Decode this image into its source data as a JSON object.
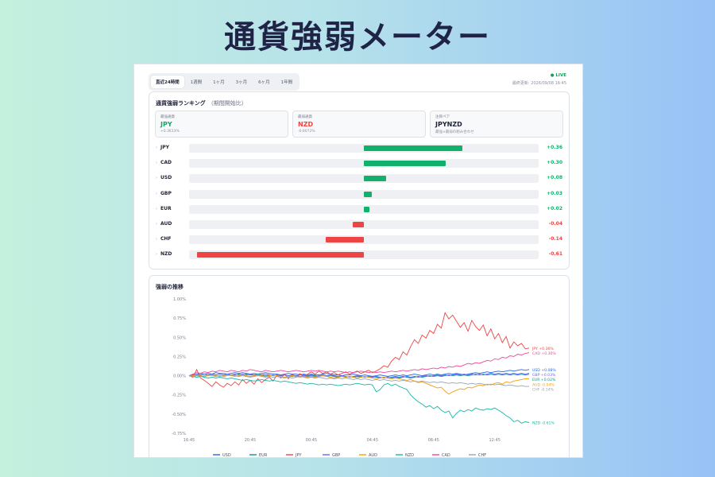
{
  "headline": "通貨強弱メーター",
  "tabs": [
    "直近24時間",
    "1週間",
    "1ヶ月",
    "3ヶ月",
    "6ヶ月",
    "1年間"
  ],
  "active_tab": 0,
  "live_label": "● LIVE",
  "updated": "最終更新: 2026/09/08 16:45",
  "ranking": {
    "title": "通貨強弱ランキング",
    "subtitle": "（期間開始比）",
    "stats": [
      {
        "label": "最強通貨",
        "value": "JPY",
        "sub": "+0.3613%",
        "color": "#12a866"
      },
      {
        "label": "最弱通貨",
        "value": "NZD",
        "sub": "-0.6072%",
        "color": "#ef4444"
      },
      {
        "label": "注目ペア",
        "value": "JPYNZD",
        "sub": "最強×最弱の組み合わせ",
        "color": "#1e2235"
      }
    ],
    "rows": [
      {
        "currency": "JPY",
        "value": 0.36,
        "label": "+0.36"
      },
      {
        "currency": "CAD",
        "value": 0.3,
        "label": "+0.30"
      },
      {
        "currency": "USD",
        "value": 0.08,
        "label": "+0.08"
      },
      {
        "currency": "GBP",
        "value": 0.03,
        "label": "+0.03"
      },
      {
        "currency": "EUR",
        "value": 0.02,
        "label": "+0.02"
      },
      {
        "currency": "AUD",
        "value": -0.04,
        "label": "-0.04"
      },
      {
        "currency": "CHF",
        "value": -0.14,
        "label": "-0.14"
      },
      {
        "currency": "NZD",
        "value": -0.61,
        "label": "-0.61"
      }
    ],
    "bar_scale_max": 0.61,
    "positive_color": "#12b06a",
    "negative_color": "#ef4444"
  },
  "trend": {
    "title": "強弱の推移"
  },
  "chart_data": {
    "type": "line",
    "x_ticks": [
      "16:45",
      "20:45",
      "00:45",
      "04:45",
      "08:45",
      "12:45"
    ],
    "x_tick_index": [
      0,
      16,
      32,
      48,
      64,
      80
    ],
    "y_ticks": [
      "1.00%",
      "0.75%",
      "0.50%",
      "0.25%",
      "0.00%",
      "-0.25%",
      "-0.50%",
      "-0.75%"
    ],
    "ylim": [
      -0.75,
      1.0
    ],
    "y_tick_values": [
      1.0,
      0.75,
      0.5,
      0.25,
      0.0,
      -0.25,
      -0.5,
      -0.75
    ],
    "series": [
      {
        "name": "USD",
        "color": "#2563eb",
        "end_label": "USD +0.08%",
        "values": [
          0,
          0.01,
          0.02,
          0.03,
          0.02,
          0.03,
          0.02,
          0.04,
          0.03,
          0.03,
          0.02,
          0.03,
          0.04,
          0.03,
          0.04,
          0.03,
          0.02,
          0.03,
          0.02,
          0.03,
          0.04,
          0.03,
          0.02,
          0.02,
          0.01,
          0.02,
          0.03,
          0.02,
          0.02,
          0.01,
          0.02,
          0.01,
          0.02,
          0.01,
          0.01,
          0.02,
          0.03,
          0.02,
          0.01,
          0.01,
          0,
          0.01,
          0.01,
          0.02,
          0.01,
          0,
          0.01,
          0,
          -0.01,
          0,
          0.01,
          0,
          -0.01,
          0,
          0.01,
          0,
          0.01,
          0,
          0.01,
          0.02,
          0.01,
          0,
          0.01,
          0.02,
          0.01,
          0.02,
          0.01,
          0.02,
          0.03,
          0.02,
          0.03,
          0.02,
          0.01,
          0.02,
          0.03,
          0.04,
          0.03,
          0.04,
          0.05,
          0.04,
          0.05,
          0.06,
          0.05,
          0.06,
          0.07,
          0.06,
          0.07,
          0.08,
          0.07,
          0.08
        ]
      },
      {
        "name": "EUR",
        "color": "#0d9488",
        "end_label": "EUR +0.02%",
        "values": [
          0,
          0.01,
          0,
          0.01,
          0.02,
          0.01,
          0.02,
          0.01,
          0.02,
          0.01,
          0.02,
          0.01,
          0.01,
          0.02,
          0.01,
          0.02,
          0.01,
          0.01,
          0.02,
          0.01,
          0,
          0.01,
          0,
          0.01,
          0,
          0.01,
          0,
          0.01,
          0,
          0.01,
          0.01,
          0,
          0.01,
          0,
          -0.01,
          0,
          -0.01,
          0,
          -0.01,
          -0.02,
          -0.01,
          -0.02,
          -0.01,
          -0.02,
          -0.01,
          -0.02,
          -0.01,
          -0.02,
          -0.01,
          -0.02,
          -0.03,
          -0.02,
          -0.03,
          -0.02,
          -0.01,
          -0.02,
          -0.01,
          -0.02,
          -0.03,
          -0.02,
          -0.01,
          -0.02,
          -0.01,
          0,
          -0.01,
          0,
          -0.01,
          0,
          0.01,
          0,
          0.01,
          0,
          0.01,
          0,
          0.01,
          0.02,
          0.01,
          0.02,
          0.01,
          0.02,
          0.01,
          0.02,
          0.01,
          0.02,
          0.01,
          0.02,
          0.01,
          0.02,
          0.01,
          0.02
        ]
      },
      {
        "name": "JPY",
        "color": "#ef4444",
        "end_label": "JPY +0.36%",
        "values": [
          0,
          -0.02,
          0.08,
          -0.03,
          -0.06,
          -0.1,
          -0.14,
          -0.08,
          -0.12,
          -0.15,
          -0.1,
          -0.13,
          -0.08,
          -0.12,
          -0.05,
          -0.1,
          -0.06,
          -0.11,
          -0.04,
          -0.09,
          -0.05,
          -0.02,
          -0.07,
          0.01,
          -0.03,
          0.02,
          -0.04,
          0.02,
          -0.02,
          0.03,
          -0.01,
          0.02,
          0.05,
          0.02,
          0.06,
          0.03,
          0.05,
          0.02,
          0.04,
          0.01,
          0.03,
          0.05,
          0.02,
          0.04,
          0.06,
          0.03,
          0.05,
          0.07,
          0.04,
          0.06,
          0.09,
          0.13,
          0.11,
          0.19,
          0.24,
          0.21,
          0.31,
          0.27,
          0.38,
          0.47,
          0.42,
          0.53,
          0.49,
          0.59,
          0.55,
          0.67,
          0.62,
          0.82,
          0.74,
          0.79,
          0.71,
          0.63,
          0.69,
          0.58,
          0.72,
          0.64,
          0.59,
          0.66,
          0.52,
          0.61,
          0.48,
          0.55,
          0.43,
          0.51,
          0.36,
          0.44,
          0.39,
          0.42,
          0.35,
          0.36
        ]
      },
      {
        "name": "GBP",
        "color": "#6366f1",
        "end_label": "GBP +0.03%",
        "values": [
          0,
          0.01,
          0.02,
          0.01,
          0.02,
          0.03,
          0.02,
          0.01,
          0.02,
          0.01,
          0.02,
          0.01,
          0.02,
          0.01,
          0.02,
          0.01,
          0.02,
          0.01,
          0,
          0.01,
          0.02,
          0.01,
          0,
          0.01,
          0,
          0.01,
          0,
          -0.01,
          0,
          -0.01,
          0,
          -0.01,
          0,
          -0.01,
          0,
          0.01,
          0,
          0.01,
          0,
          -0.01,
          0,
          -0.01,
          -0.02,
          -0.01,
          0,
          -0.01,
          -0.02,
          -0.01,
          -0.02,
          -0.01,
          -0.02,
          -0.03,
          -0.02,
          -0.03,
          -0.02,
          -0.03,
          -0.02,
          -0.01,
          -0.02,
          -0.01,
          -0.02,
          -0.01,
          0,
          -0.01,
          0,
          0.01,
          0,
          0.01,
          0,
          0.01,
          0.02,
          0.01,
          0.02,
          0.01,
          0.02,
          0.01,
          0.02,
          0.01,
          0.02,
          0.03,
          0.02,
          0.03,
          0.02,
          0.03,
          0.02,
          0.03,
          0.02,
          0.03,
          0.02,
          0.03
        ]
      },
      {
        "name": "AUD",
        "color": "#f59e0b",
        "end_label": "AUD -0.04%",
        "values": [
          0,
          0,
          0.01,
          0,
          -0.01,
          0,
          0.01,
          0,
          -0.01,
          0,
          0.01,
          0,
          -0.01,
          0,
          0.01,
          0,
          -0.01,
          0,
          0.01,
          0,
          -0.01,
          0,
          0.01,
          0,
          -0.01,
          -0.02,
          -0.01,
          0,
          -0.01,
          -0.02,
          -0.01,
          -0.02,
          -0.01,
          -0.02,
          -0.01,
          0,
          -0.01,
          -0.02,
          -0.03,
          -0.02,
          -0.01,
          -0.02,
          -0.01,
          -0.02,
          -0.03,
          -0.02,
          -0.01,
          -0.02,
          -0.03,
          -0.04,
          -0.03,
          -0.02,
          -0.03,
          -0.04,
          -0.03,
          -0.04,
          -0.05,
          -0.06,
          -0.05,
          -0.07,
          -0.09,
          -0.08,
          -0.1,
          -0.12,
          -0.14,
          -0.16,
          -0.15,
          -0.2,
          -0.24,
          -0.21,
          -0.19,
          -0.17,
          -0.18,
          -0.15,
          -0.16,
          -0.14,
          -0.12,
          -0.13,
          -0.11,
          -0.12,
          -0.1,
          -0.09,
          -0.11,
          -0.08,
          -0.09,
          -0.07,
          -0.06,
          -0.05,
          -0.04,
          -0.04
        ]
      },
      {
        "name": "NZD",
        "color": "#14b8a6",
        "end_label": "NZD -0.61%",
        "values": [
          0,
          -0.01,
          -0.02,
          -0.01,
          -0.02,
          -0.03,
          -0.02,
          -0.03,
          -0.02,
          -0.03,
          -0.04,
          -0.03,
          -0.04,
          -0.05,
          -0.06,
          -0.05,
          -0.06,
          -0.07,
          -0.06,
          -0.05,
          -0.06,
          -0.07,
          -0.06,
          -0.07,
          -0.08,
          -0.07,
          -0.08,
          -0.09,
          -0.1,
          -0.09,
          -0.1,
          -0.11,
          -0.1,
          -0.11,
          -0.12,
          -0.11,
          -0.12,
          -0.11,
          -0.12,
          -0.13,
          -0.12,
          -0.11,
          -0.12,
          -0.11,
          -0.1,
          -0.11,
          -0.12,
          -0.11,
          -0.12,
          -0.21,
          -0.18,
          -0.12,
          -0.1,
          -0.13,
          -0.11,
          -0.14,
          -0.16,
          -0.18,
          -0.25,
          -0.3,
          -0.34,
          -0.37,
          -0.41,
          -0.39,
          -0.43,
          -0.4,
          -0.45,
          -0.48,
          -0.46,
          -0.55,
          -0.49,
          -0.45,
          -0.47,
          -0.44,
          -0.46,
          -0.42,
          -0.44,
          -0.45,
          -0.43,
          -0.44,
          -0.42,
          -0.45,
          -0.48,
          -0.52,
          -0.55,
          -0.6,
          -0.58,
          -0.62,
          -0.6,
          -0.61
        ]
      },
      {
        "name": "CAD",
        "color": "#ec4899",
        "end_label": "CAD +0.30%",
        "values": [
          0,
          0.02,
          0.04,
          0.03,
          0.05,
          0.04,
          0.06,
          0.05,
          0.07,
          0.06,
          0.05,
          0.07,
          0.06,
          0.05,
          0.07,
          0.06,
          0.08,
          0.07,
          0.06,
          0.05,
          0.07,
          0.06,
          0.05,
          0.06,
          0.07,
          0.06,
          0.05,
          0.06,
          0.07,
          0.06,
          0.05,
          0.06,
          0.07,
          0.06,
          0.07,
          0.06,
          0.05,
          0.06,
          0.05,
          0.06,
          0.05,
          0.04,
          0.05,
          0.04,
          0.05,
          0.06,
          0.05,
          0.04,
          0.05,
          0.04,
          0.05,
          0.04,
          0.05,
          0.06,
          0.05,
          0.06,
          0.07,
          0.06,
          0.07,
          0.08,
          0.07,
          0.09,
          0.08,
          0.09,
          0.1,
          0.09,
          0.11,
          0.1,
          0.12,
          0.11,
          0.13,
          0.12,
          0.14,
          0.16,
          0.15,
          0.17,
          0.16,
          0.18,
          0.2,
          0.19,
          0.22,
          0.21,
          0.24,
          0.23,
          0.26,
          0.25,
          0.28,
          0.27,
          0.29,
          0.3
        ]
      },
      {
        "name": "CHF",
        "color": "#94a3b8",
        "end_label": "CHF -0.14%",
        "values": [
          0,
          -0.01,
          0,
          -0.01,
          0,
          0.01,
          0,
          -0.01,
          0,
          -0.01,
          0,
          0.01,
          0,
          -0.01,
          0,
          -0.01,
          -0.02,
          -0.01,
          0,
          -0.01,
          -0.02,
          -0.01,
          -0.02,
          -0.01,
          -0.02,
          -0.03,
          -0.02,
          -0.03,
          -0.02,
          -0.01,
          -0.02,
          -0.03,
          -0.02,
          -0.03,
          -0.02,
          -0.03,
          -0.04,
          -0.03,
          -0.04,
          -0.03,
          -0.04,
          -0.03,
          -0.04,
          -0.05,
          -0.04,
          -0.05,
          -0.04,
          -0.05,
          -0.06,
          -0.05,
          -0.06,
          -0.05,
          -0.06,
          -0.07,
          -0.06,
          -0.07,
          -0.06,
          -0.07,
          -0.08,
          -0.07,
          -0.08,
          -0.07,
          -0.08,
          -0.09,
          -0.08,
          -0.09,
          -0.08,
          -0.09,
          -0.1,
          -0.09,
          -0.1,
          -0.09,
          -0.1,
          -0.11,
          -0.1,
          -0.11,
          -0.1,
          -0.11,
          -0.12,
          -0.11,
          -0.12,
          -0.11,
          -0.12,
          -0.13,
          -0.12,
          -0.13,
          -0.14,
          -0.13,
          -0.14,
          -0.14
        ]
      }
    ],
    "legend": [
      "USD",
      "EUR",
      "JPY",
      "GBP",
      "AUD",
      "NZD",
      "CAD",
      "CHF"
    ],
    "legend_position": "bottom",
    "grid": false
  }
}
